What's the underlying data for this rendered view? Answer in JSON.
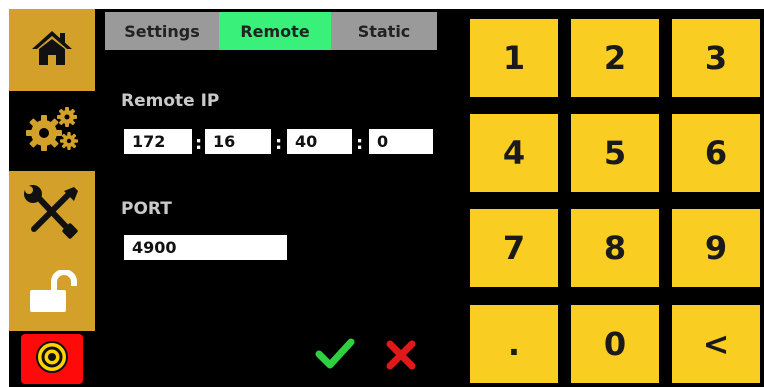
{
  "tabs": [
    {
      "label": "Settings"
    },
    {
      "label": "Remote"
    },
    {
      "label": "Static"
    }
  ],
  "remote_ip": {
    "label": "Remote IP",
    "octets": [
      "172",
      "16",
      "40",
      "0"
    ],
    "separator": ":"
  },
  "port": {
    "label": "PORT",
    "value": "4900"
  },
  "keypad": {
    "keys": [
      "1",
      "2",
      "3",
      "4",
      "5",
      "6",
      "7",
      "8",
      "9",
      ".",
      "0",
      "<"
    ]
  },
  "icons": {
    "home": "home-icon",
    "settings": "gears-icon",
    "tools": "wrench-screwdriver-icon",
    "lock": "unlocked-padlock-icon",
    "estop": "emergency-stop-icon",
    "confirm": "checkmark-icon",
    "cancel": "x-icon"
  },
  "colors": {
    "sidebar_gold": "#d3a12a",
    "tab_active": "#38f07a",
    "tab_inactive": "#9a9a9a",
    "keypad_yellow": "#f9cd22",
    "confirm_green": "#2fcf3f",
    "cancel_red": "#e01818",
    "estop_red": "#ff0a0a",
    "estop_yellow": "#ffd400"
  }
}
